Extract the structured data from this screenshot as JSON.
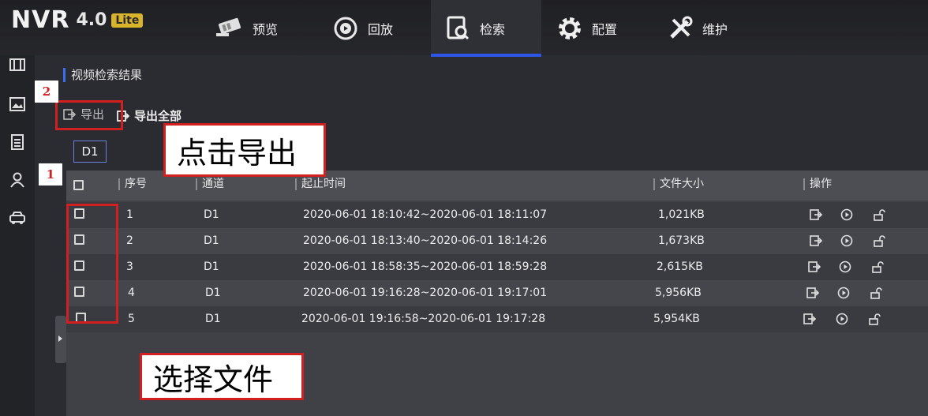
{
  "brand": {
    "name": "NVR",
    "version": "4.0",
    "edition": "Lite"
  },
  "nav": {
    "preview": "预览",
    "playback": "回放",
    "search": "检索",
    "config": "配置",
    "maintain": "维护"
  },
  "section_title": "视频检索结果",
  "toolbar": {
    "export_label": "导出",
    "export_all_label": "导出全部"
  },
  "channel_filter": "D1",
  "table": {
    "headers": {
      "index": "序号",
      "channel": "通道",
      "time": "起止时间",
      "size": "文件大小",
      "ops": "操作"
    },
    "rows": [
      {
        "index": "1",
        "channel": "D1",
        "time": "2020-06-01 18:10:42~2020-06-01 18:11:07",
        "size": "1,021KB"
      },
      {
        "index": "2",
        "channel": "D1",
        "time": "2020-06-01 18:13:40~2020-06-01 18:14:26",
        "size": "1,673KB"
      },
      {
        "index": "3",
        "channel": "D1",
        "time": "2020-06-01 18:58:35~2020-06-01 18:59:28",
        "size": "2,615KB"
      },
      {
        "index": "4",
        "channel": "D1",
        "time": "2020-06-01 19:16:28~2020-06-01 19:17:01",
        "size": "5,956KB"
      },
      {
        "index": "5",
        "channel": "D1",
        "time": "2020-06-01 19:16:58~2020-06-01 19:17:28",
        "size": "5,954KB"
      }
    ]
  },
  "annotations": {
    "step1": "1",
    "step2": "2",
    "click_export": "点击导出",
    "select_file": "选择文件"
  },
  "colors": {
    "accent": "#2d55e6",
    "annotation_red": "#d21f1f",
    "lite_badge": "#d9b32a"
  }
}
